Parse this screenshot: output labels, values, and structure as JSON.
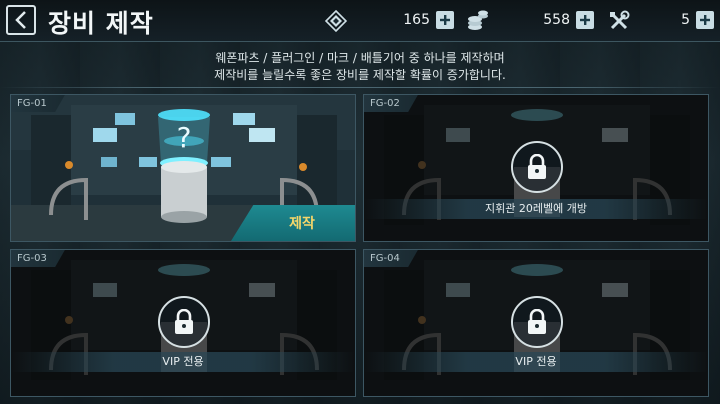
{
  "header": {
    "title": "장비 제작",
    "resources": [
      {
        "icon": "diamond-chip-icon",
        "value": "165"
      },
      {
        "icon": "coin-stack-icon",
        "value": "558"
      },
      {
        "icon": "tools-icon",
        "value": "5"
      }
    ]
  },
  "description": {
    "line1": "웨폰파츠 / 플러그인 / 마크 / 배틀기어 중 하나를 제작하며",
    "line2": "제작비를 늘릴수록 좋은 장비를 제작할 확률이 증가합니다."
  },
  "slots": [
    {
      "id": "FG-01",
      "state": "open",
      "action_label": "제작"
    },
    {
      "id": "FG-02",
      "state": "locked",
      "lock_label": "지휘관 20레벨에 개방"
    },
    {
      "id": "FG-03",
      "state": "locked",
      "lock_label": "VIP 전용"
    },
    {
      "id": "FG-04",
      "state": "locked",
      "lock_label": "VIP 전용"
    }
  ],
  "colors": {
    "accent": "#1e8a91",
    "craft_text": "#f6d76a",
    "hologram": "#4fe3ff"
  }
}
